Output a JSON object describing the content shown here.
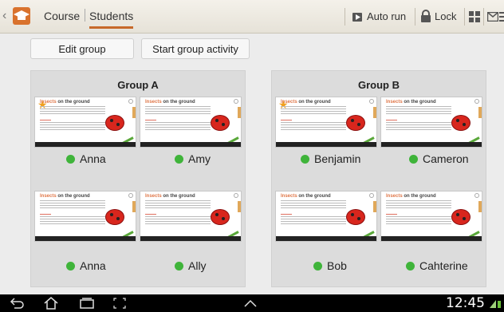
{
  "header": {
    "tabs": [
      {
        "label": "Course"
      },
      {
        "label": "Students"
      }
    ],
    "actions": {
      "auto_run": "Auto run",
      "lock": "Lock"
    }
  },
  "buttons": {
    "edit_group": "Edit group",
    "start_group_activity": "Start group activity"
  },
  "thumbnail": {
    "title_prefix": "Insects",
    "title_rest": " on the ground"
  },
  "groups": [
    {
      "name": "Group A",
      "students": [
        {
          "name": "Anna",
          "status": "online",
          "starred": true
        },
        {
          "name": "Amy",
          "status": "online",
          "starred": false
        },
        {
          "name": "Anna",
          "status": "online",
          "starred": false
        },
        {
          "name": "Ally",
          "status": "online",
          "starred": false
        }
      ]
    },
    {
      "name": "Group B",
      "students": [
        {
          "name": "Benjamin",
          "status": "online",
          "starred": true
        },
        {
          "name": "Cameron",
          "status": "online",
          "starred": false
        },
        {
          "name": "Bob",
          "status": "online",
          "starred": false
        },
        {
          "name": "Cahterine",
          "status": "online",
          "starred": false
        }
      ]
    }
  ],
  "status_bar": {
    "time": "12:45"
  },
  "colors": {
    "accent": "#c7692a",
    "online": "#3fb43a"
  }
}
